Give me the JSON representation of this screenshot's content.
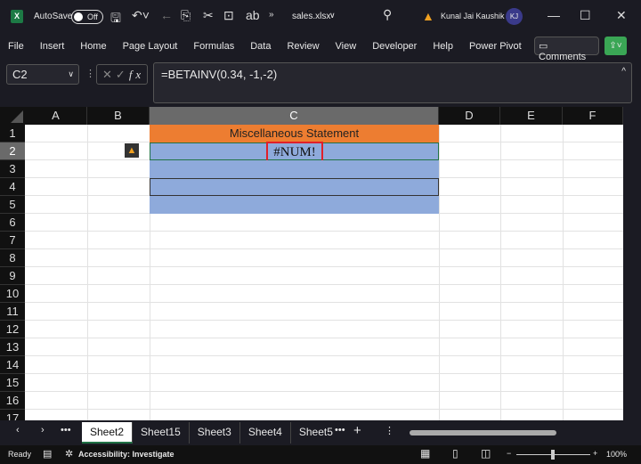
{
  "titlebar": {
    "autosave_label": "AutoSave",
    "autosave_state": "Off",
    "filename": "sales.xlsx",
    "user_name": "Kunal Jai Kaushik",
    "user_initials": "KJ",
    "app_icon": "X"
  },
  "menu": [
    "File",
    "Insert",
    "Home",
    "Page Layout",
    "Formulas",
    "Data",
    "Review",
    "View",
    "Developer",
    "Help",
    "Power Pivot"
  ],
  "comments_label": "Comments",
  "namebox": "C2",
  "formula": "=BETAINV(0.34, -1,-2)",
  "fx_label": "fx",
  "columns": [
    "A",
    "B",
    "C",
    "D",
    "E",
    "F"
  ],
  "rows": [
    "1",
    "2",
    "3",
    "4",
    "5",
    "6",
    "7",
    "8",
    "9",
    "10",
    "11",
    "12",
    "13",
    "14",
    "15",
    "16",
    "17"
  ],
  "cells": {
    "C1": "Miscellaneous Statement",
    "C2": "#NUM!"
  },
  "colors": {
    "header_fill": "#ed7d31",
    "band_fill": "#8eaadb",
    "highlight": "#e0202a"
  },
  "sheets": [
    "Sheet2",
    "Sheet15",
    "Sheet3",
    "Sheet4",
    "Sheet5"
  ],
  "active_sheet": "Sheet2",
  "status": {
    "ready": "Ready",
    "accessibility": "Accessibility: Investigate",
    "zoom": "100%"
  }
}
